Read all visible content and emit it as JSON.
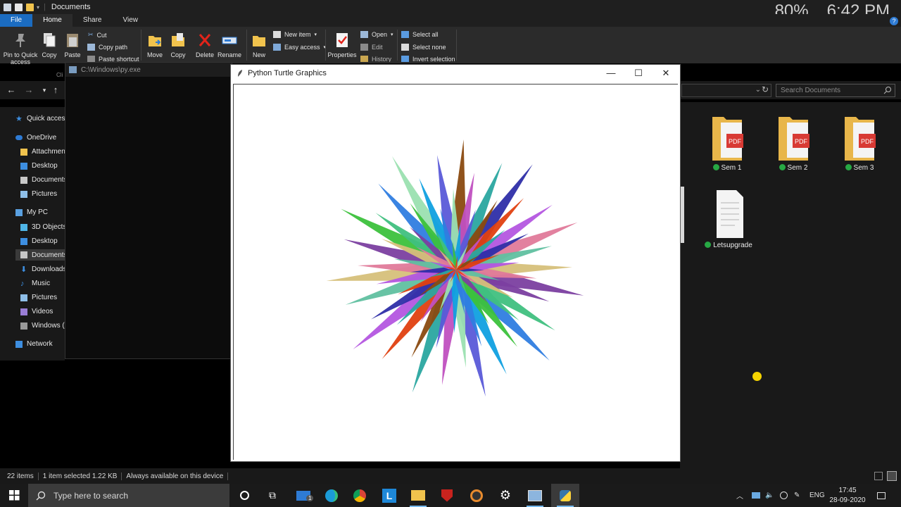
{
  "overlay": {
    "zoom": "80%",
    "time": "6:42 PM"
  },
  "explorer": {
    "title": "Documents",
    "tabs": [
      {
        "label": "File"
      },
      {
        "label": "Home"
      },
      {
        "label": "Share"
      },
      {
        "label": "View"
      }
    ],
    "ribbon": {
      "pin": "Pin to Quick access",
      "copy": "Copy",
      "paste": "Paste",
      "cut": "Cut",
      "copy_path": "Copy path",
      "paste_shortcut": "Paste shortcut",
      "clipboard_group": "Cli",
      "move": "Move",
      "copy_to": "Copy",
      "delete": "Delete",
      "rename": "Rename",
      "new": "New",
      "new_item": "New item",
      "easy_access": "Easy access",
      "properties": "Properties",
      "open": "Open",
      "edit": "Edit",
      "history": "History",
      "select_all": "Select all",
      "select_none": "Select none",
      "invert_selection": "Invert selection"
    },
    "search_placeholder": "Search Documents",
    "nav": [
      {
        "label": "Quick access"
      },
      {
        "label": "OneDrive"
      },
      {
        "label": "Attachmen"
      },
      {
        "label": "Desktop"
      },
      {
        "label": "Documents"
      },
      {
        "label": "Pictures"
      },
      {
        "label": "My PC"
      },
      {
        "label": "3D Objects"
      },
      {
        "label": "Desktop"
      },
      {
        "label": "Documents"
      },
      {
        "label": "Downloads"
      },
      {
        "label": "Music"
      },
      {
        "label": "Pictures"
      },
      {
        "label": "Videos"
      },
      {
        "label": "Windows ("
      },
      {
        "label": "Network"
      }
    ],
    "files": [
      {
        "name": "Sem 1"
      },
      {
        "name": "Sem 2"
      },
      {
        "name": "Sem 3"
      },
      {
        "name": "Letsupgrade"
      }
    ],
    "status": {
      "items": "22 items",
      "selected": "1 item selected  1.22 KB",
      "availability": "Always available on this device"
    }
  },
  "console": {
    "title": "C:\\Windows\\py.exe"
  },
  "turtle": {
    "title": "Python Turtle Graphics",
    "minimize": "—",
    "maximize": "☐",
    "close": "✕"
  },
  "taskbar": {
    "search_placeholder": "Type here to search",
    "mail_badge": "1",
    "language": "ENG",
    "clock_time": "17:45",
    "clock_date": "28-09-2020"
  },
  "colors": {
    "accent": "#1b6cc1",
    "sync_check": "#27a844",
    "cursor_highlight": "#f5d300"
  }
}
